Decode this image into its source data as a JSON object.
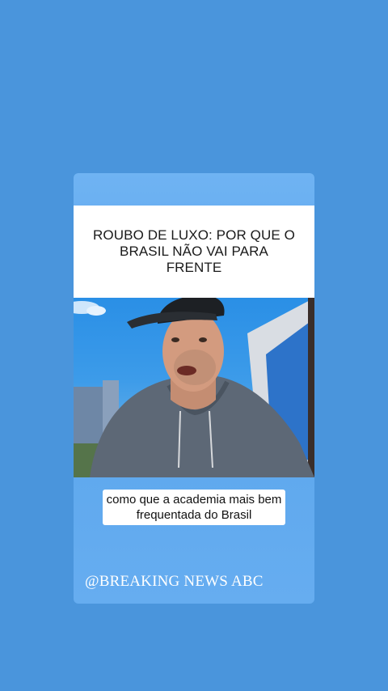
{
  "post": {
    "headline": "ROUBO DE LUXO: POR QUE O BRASIL NÃO VAI PARA FRENTE",
    "caption": "como que a academia mais bem frequentada do Brasil",
    "watermark": "@BREAKING NEWS ABC"
  },
  "colors": {
    "background": "#4a95dc",
    "card": "#66adf0",
    "headline_box": "#ffffff",
    "caption_box": "#ffffff",
    "watermark_text": "#ffffff"
  }
}
